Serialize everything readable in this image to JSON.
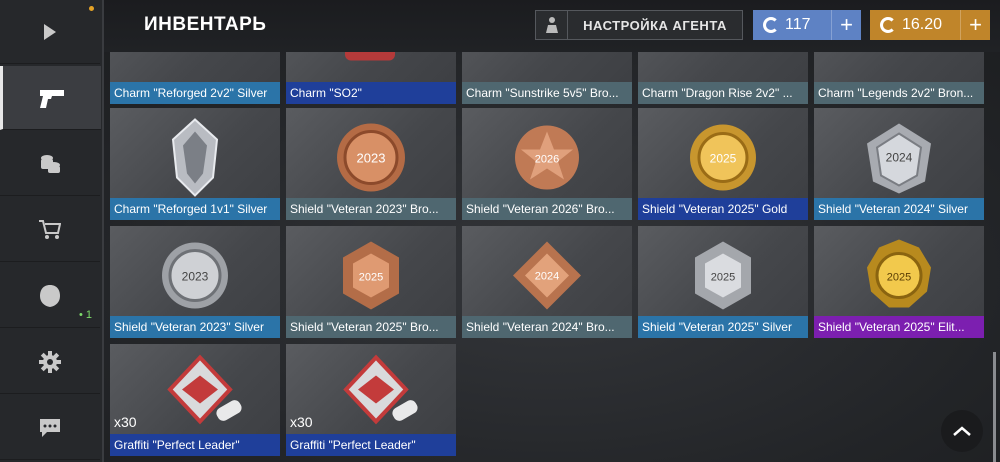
{
  "header": {
    "title": "ИНВЕНТАРЬ",
    "agent_button": "НАСТРОЙКА АГЕНТА",
    "currency_blue": "117",
    "currency_gold": "16.20",
    "plus": "+"
  },
  "sidebar": {
    "items": [
      {
        "name": "play-icon"
      },
      {
        "name": "pistol-icon",
        "active": true
      },
      {
        "name": "coins-icon"
      },
      {
        "name": "cart-icon"
      },
      {
        "name": "helmet-icon",
        "badge": "• 1"
      },
      {
        "name": "gear-icon"
      },
      {
        "name": "chat-icon"
      }
    ]
  },
  "inventory": {
    "row1": [
      {
        "label": "Charm \"Reforged 2v2\" Silver",
        "rarity": "blue"
      },
      {
        "label": "Charm \"SO2\"",
        "rarity": "navy"
      },
      {
        "label": "Charm \"Sunstrike 5v5\" Bro...",
        "rarity": "gray"
      },
      {
        "label": "Charm \"Dragon Rise 2v2\" ...",
        "rarity": "gray"
      },
      {
        "label": "Charm \"Legends 2v2\" Bron...",
        "rarity": "gray"
      }
    ],
    "row2": [
      {
        "label": "Charm \"Reforged 1v1\" Silver",
        "rarity": "blue",
        "art": "silver-crystal"
      },
      {
        "label": "Shield \"Veteran 2023\" Bro...",
        "rarity": "gray",
        "art": "bronze",
        "year": "2023"
      },
      {
        "label": "Shield \"Veteran 2026\" Bro...",
        "rarity": "gray",
        "art": "bronze",
        "year": "2026"
      },
      {
        "label": "Shield \"Veteran 2025\" Gold",
        "rarity": "navy",
        "art": "gold",
        "year": "2025"
      },
      {
        "label": "Shield \"Veteran 2024\" Silver",
        "rarity": "blue",
        "art": "silver",
        "year": "2024"
      }
    ],
    "row3": [
      {
        "label": "Shield \"Veteran 2023\" Silver",
        "rarity": "blue",
        "art": "silver",
        "year": "2023"
      },
      {
        "label": "Shield \"Veteran 2025\" Bro...",
        "rarity": "gray",
        "art": "bronze",
        "year": "2025"
      },
      {
        "label": "Shield \"Veteran 2024\" Bro...",
        "rarity": "gray",
        "art": "bronze",
        "year": "2024"
      },
      {
        "label": "Shield \"Veteran 2025\" Silver",
        "rarity": "blue",
        "art": "silver",
        "year": "2025"
      },
      {
        "label": "Shield \"Veteran 2025\" Elit...",
        "rarity": "purple",
        "art": "gold",
        "year": "2025"
      }
    ],
    "row4": [
      {
        "label": "Graffiti \"Perfect Leader\"",
        "rarity": "navy",
        "count": "x30"
      },
      {
        "label": "Graffiti \"Perfect Leader\"",
        "rarity": "navy",
        "count": "x30"
      }
    ]
  },
  "colors": {
    "blue": "#2b74a8",
    "navy": "#1f3f9a",
    "gray": "#4f6770",
    "purple": "#7c1fb0",
    "gold": "#c0852a",
    "currency_blue": "#5e82c4"
  }
}
